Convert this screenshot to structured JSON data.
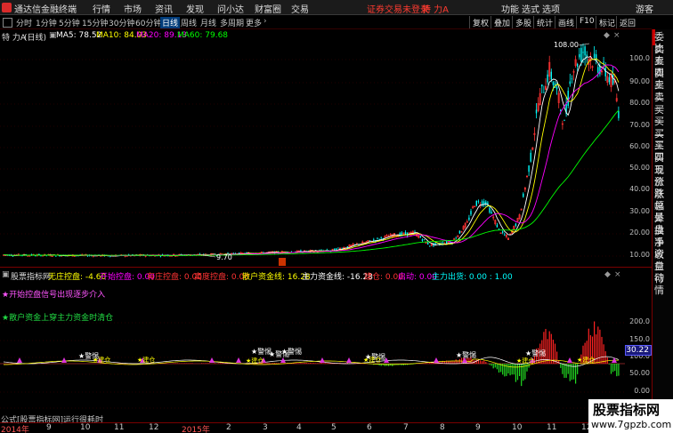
{
  "menu": {
    "brand": "通达信金融终端",
    "items": [
      "行情",
      "市场",
      "资讯",
      "发现",
      "问小达",
      "财富圈",
      "交易"
    ],
    "alert": "证券交易未登录",
    "stock_name": "特 力A",
    "right_items": [
      "功能",
      "选式",
      "选项"
    ],
    "guest": "游客"
  },
  "periods": {
    "items": [
      "分时",
      "1分钟",
      "5分钟",
      "15分钟",
      "30分钟",
      "60分钟",
      "日线",
      "周线",
      "月线",
      "多周期",
      "更多"
    ],
    "active": "日线"
  },
  "toolbar": [
    "复权",
    "叠加",
    "多股",
    "统计",
    "画线",
    "F10",
    "标记",
    "返回"
  ],
  "main_header": {
    "stock": "特 力A",
    "period": "(日线)",
    "ma5": "MA5: 78.52",
    "ma10": "MA10: 84.03",
    "ma20": "MA20: 89.13",
    "ma60": "MA60: 79.68",
    "high_label": "108.00",
    "low_label": "9.70"
  },
  "indicator_header": {
    "name": "股票指标网",
    "f1": "无庄控盘: -4.60",
    "f2": "开始控盘: 0.00",
    "f3": "有庄控盘: 0.00",
    "f4": "高度控盘: 0.00",
    "f5": "散户资金线: 16.28",
    "f6": "主力资金线: -16.28",
    "f7": "建仓: 0.00",
    "f8": "启动: 0.00",
    "f9": "主力出货: 0.00 : 1.00"
  },
  "notes": {
    "n1": "★开始控盘信号出现逐步介入",
    "n2": "★散户资金上穿主力资金时清仓"
  },
  "price_axis": [
    "100.0",
    "90.00",
    "80.00",
    "70.00",
    "60.00",
    "50.00",
    "40.00",
    "30.00",
    "20.00",
    "10.00"
  ],
  "ind_axis": [
    "200.0",
    "150.0",
    "100.0",
    "50.00",
    "0.00",
    "-50.0"
  ],
  "cursor_value": "30.22",
  "formula_text": "公式[股票指标网]运行很耗时",
  "time_axis": [
    "2014年",
    "9",
    "10",
    "11",
    "12",
    "2015年",
    "2",
    "3",
    "4",
    "5",
    "6",
    "7",
    "8",
    "9",
    "10",
    "11",
    "12"
  ],
  "side_panel": [
    "委比",
    "卖五",
    "卖四",
    "卖三",
    "卖二",
    "卖一",
    "买一",
    "买二",
    "买三",
    "买四",
    "买五",
    "现价",
    "涨跌",
    "涨幅",
    "总量",
    "外盘",
    "换手",
    "净资",
    "收益",
    "自动",
    "行情"
  ],
  "labels": {
    "warn": "警惕",
    "buy": "建仓"
  },
  "watermark": {
    "title": "股票指标网",
    "url": "www.7gpzb.com"
  },
  "colors": {
    "up": "#ff3333",
    "down": "#00ffff",
    "ma5": "#ffffff",
    "ma10": "#ffff00",
    "ma20": "#ff00ff",
    "ma60": "#00ff00",
    "accent": "#ff3b30"
  }
}
